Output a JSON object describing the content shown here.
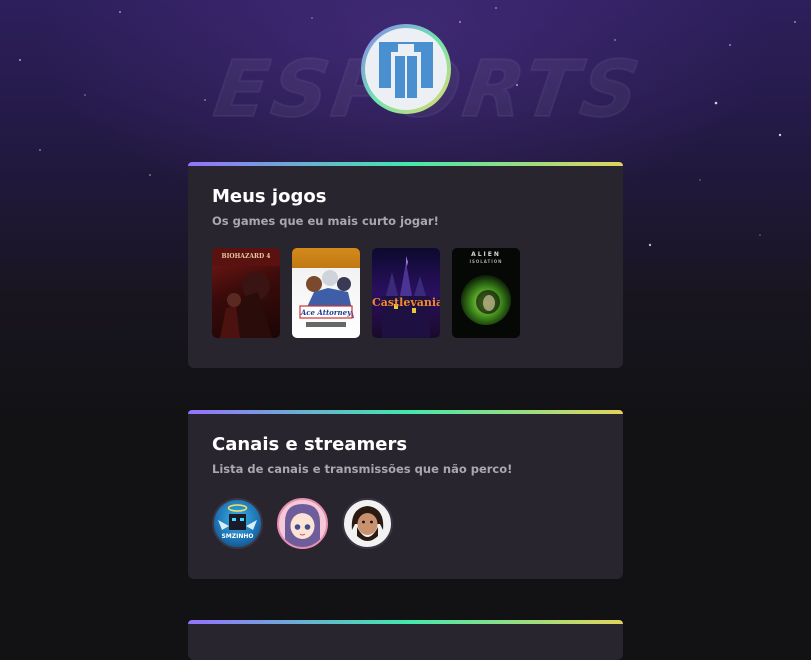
{
  "profile": {
    "avatar_icon": "profile-logo-icon",
    "watermark": "ESPORTS"
  },
  "sections": [
    {
      "title": "Meus jogos",
      "subtitle": "Os games que eu mais curto jogar!",
      "games": [
        {
          "name": "Resident Evil 4",
          "icon": "resident-evil-4-cover"
        },
        {
          "name": "Ace Attorney",
          "icon": "ace-attorney-cover"
        },
        {
          "name": "Castlevania",
          "icon": "castlevania-cover"
        },
        {
          "name": "Alien Isolation",
          "icon": "alien-isolation-cover"
        }
      ]
    },
    {
      "title": "Canais e streamers",
      "subtitle": "Lista de canais e transmissões que não perco!",
      "streamers": [
        {
          "name": "Smzinho",
          "icon": "smzinho-avatar"
        },
        {
          "name": "Anime streamer",
          "icon": "anime-girl-avatar"
        },
        {
          "name": "Bearded streamer",
          "icon": "bearded-man-avatar"
        }
      ]
    }
  ],
  "cover_texts": {
    "re4": "BIOHAZARD 4",
    "ace": "Ace Attorney",
    "castlevania": "Castlevania",
    "alien": "ALIEN",
    "alien_sub": "ISOLATION",
    "smzinho": "SMZINHO"
  },
  "colors": {
    "card_bg": "#29252f",
    "accent_gradient": [
      "#9572fc",
      "#43e7ad",
      "#e2d45c"
    ],
    "title": "#ffffff",
    "subtitle": "#a8a8b3"
  }
}
